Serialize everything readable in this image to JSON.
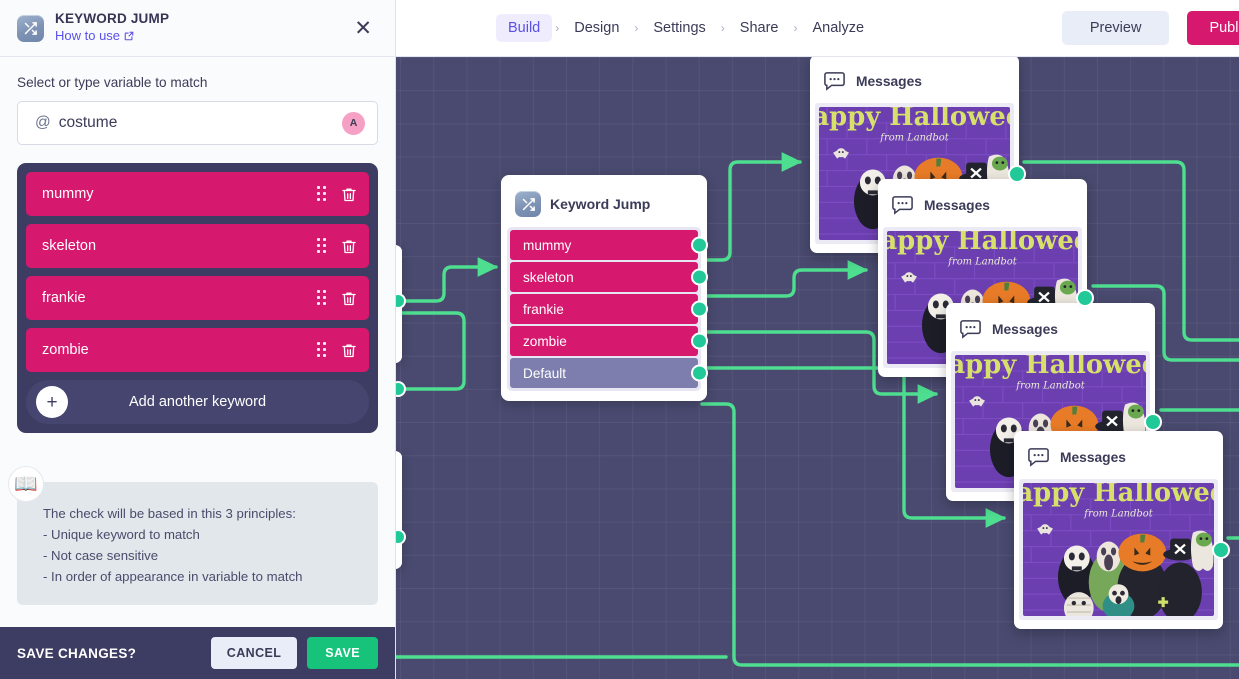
{
  "topbar": {
    "nav_items": [
      {
        "label": "Build",
        "active": true
      },
      {
        "label": "Design",
        "active": false
      },
      {
        "label": "Settings",
        "active": false
      },
      {
        "label": "Share",
        "active": false
      },
      {
        "label": "Analyze",
        "active": false
      }
    ],
    "separator": "›",
    "preview_label": "Preview",
    "publish_label": "Publish",
    "accent_active_color": "#5a51e8",
    "accent_active_bg": "#eeecfd"
  },
  "panel": {
    "title": "KEYWORD JUMP",
    "how_to_use_label": "How to use",
    "external_link_glyph": "⧉",
    "close_glyph": "✕",
    "variable_section_label": "Select or type variable to match",
    "variable_at_symbol": "@",
    "variable_value": "costume",
    "variable_type_badge": "A",
    "variable_badge_color": "#f5a0c4",
    "keywords": [
      "mummy",
      "skeleton",
      "frankie",
      "zombie"
    ],
    "add_keyword_label": "Add another keyword",
    "add_keyword_plus": "+",
    "hint_icon": "📖",
    "hint_text": "The check will be based in this 3 principles:\n- Unique keyword to match\n- Not case sensitive\n- In order of appearance in variable to match",
    "footer": {
      "prompt": "SAVE CHANGES?",
      "cancel_label": "CANCEL",
      "save_label": "SAVE",
      "save_color": "#17c37b"
    },
    "keyword_color": "#d6186e",
    "keyword_box_color": "#3d3d63"
  },
  "canvas": {
    "background_color": "#4a4a70",
    "edge_color": "#4ede8f",
    "port_color": "#20c997",
    "keyword_jump_node": {
      "title": "Keyword Jump",
      "icon": "shuffle-icon",
      "rows": [
        {
          "label": "mummy",
          "is_default": false
        },
        {
          "label": "skeleton",
          "is_default": false
        },
        {
          "label": "frankie",
          "is_default": false
        },
        {
          "label": "zombie",
          "is_default": false
        },
        {
          "label": "Default",
          "is_default": true
        }
      ]
    },
    "message_nodes": [
      {
        "title": "Messages",
        "image_title": "Happy Halloween",
        "image_subtitle": "from Landbot"
      },
      {
        "title": "Messages",
        "image_title": "Happy Halloween",
        "image_subtitle": "from Landbot"
      },
      {
        "title": "Messages",
        "image_title": "Happy Halloween",
        "image_subtitle": "from Landbot"
      },
      {
        "title": "Messages",
        "image_title": "Happy Halloween",
        "image_subtitle": "from Landbot"
      }
    ]
  }
}
